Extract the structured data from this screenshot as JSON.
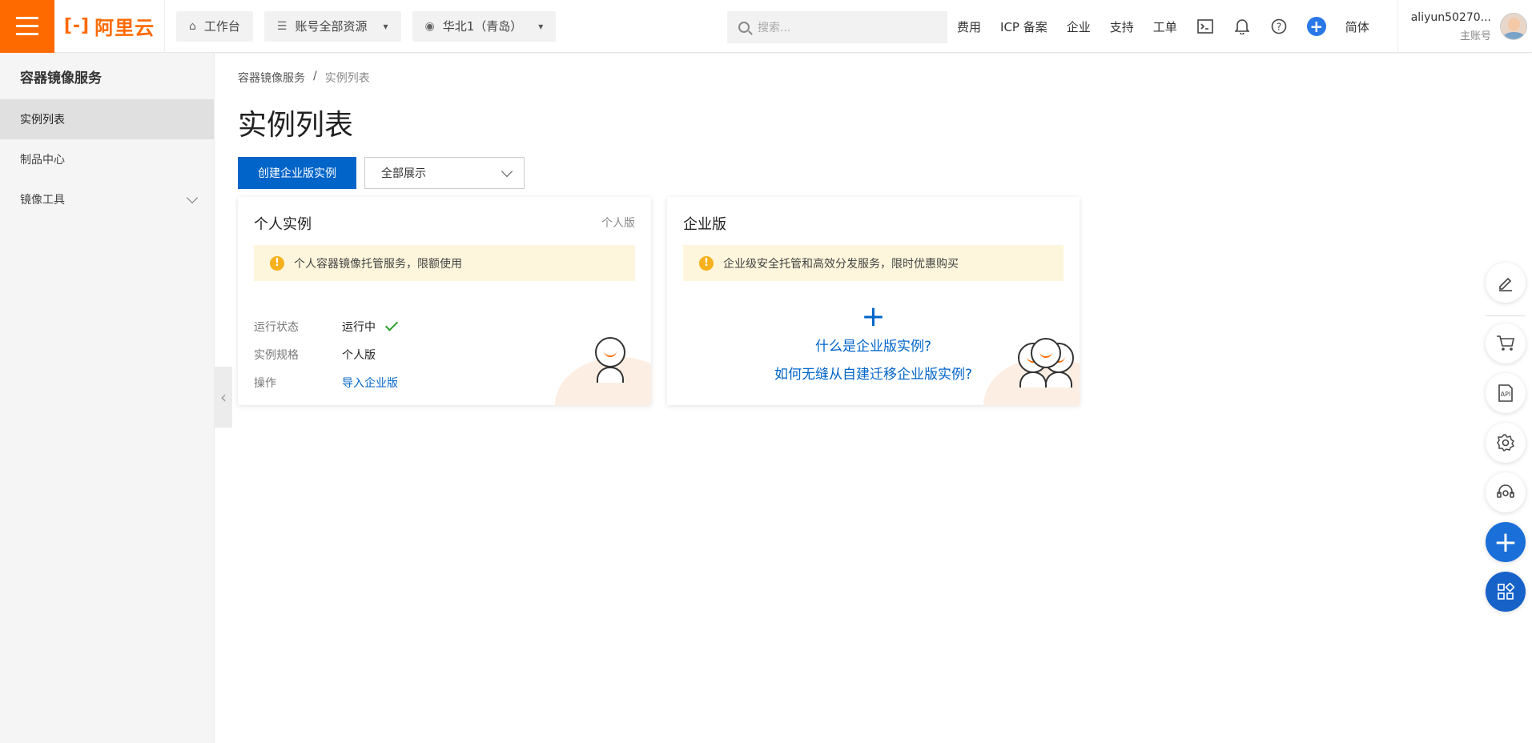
{
  "topbar": {
    "logo_text": "阿里云",
    "workbench": "工作台",
    "resources": "账号全部资源",
    "region": "华北1（青岛）",
    "search_placeholder": "搜索...",
    "links": [
      "费用",
      "ICP 备案",
      "企业",
      "支持",
      "工单"
    ],
    "language": "简体",
    "user_name": "aliyun50270...",
    "user_role": "主账号"
  },
  "sidebar": {
    "title": "容器镜像服务",
    "items": [
      {
        "label": "实例列表",
        "active": true
      },
      {
        "label": "制品中心",
        "active": false
      },
      {
        "label": "镜像工具",
        "active": false,
        "expandable": true
      }
    ]
  },
  "breadcrumb": {
    "root": "容器镜像服务",
    "separator": "/",
    "current": "实例列表"
  },
  "page": {
    "title": "实例列表",
    "create_button": "创建企业版实例",
    "filter_value": "全部展示"
  },
  "cards": {
    "personal": {
      "title": "个人实例",
      "tag": "个人版",
      "notice": "个人容器镜像托管服务，限额使用",
      "status_label": "运行状态",
      "status_value": "运行中",
      "spec_label": "实例规格",
      "spec_value": "个人版",
      "action_label": "操作",
      "action_value": "导入企业版"
    },
    "enterprise": {
      "title": "企业版",
      "notice": "企业级安全托管和高效分发服务，限时优惠购买",
      "link1": "什么是企业版实例?",
      "link2": "如何无缝从自建迁移企业版实例?"
    }
  },
  "colors": {
    "brand_orange": "#ff6a00",
    "primary_blue": "#0064c8",
    "notice_bg": "#fef6dc",
    "success_green": "#2ca12c"
  }
}
